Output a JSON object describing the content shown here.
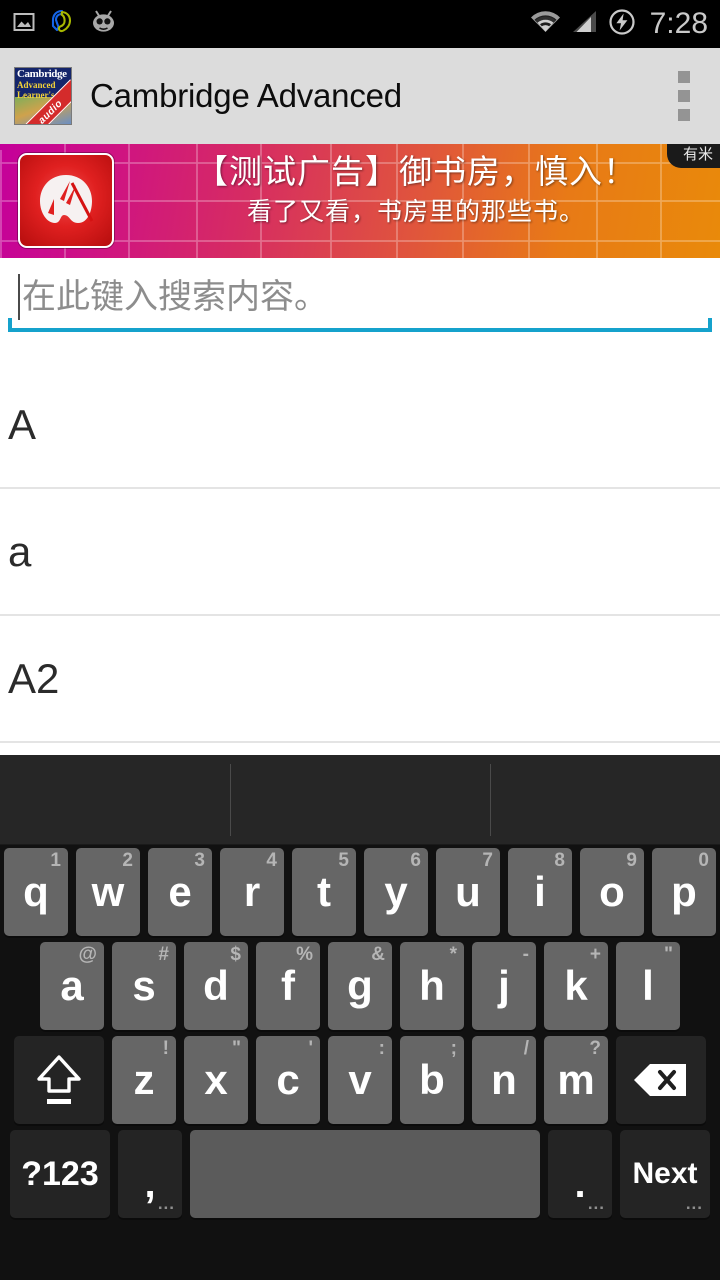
{
  "statusbar": {
    "time": "7:28",
    "left_icons": [
      {
        "name": "screenshot-icon",
        "label": "screenshot"
      },
      {
        "name": "headset-icon",
        "label": "headset"
      },
      {
        "name": "cyanogenmod-icon",
        "label": "cyanogenmod"
      }
    ],
    "right_icons": [
      {
        "name": "wifi-icon",
        "label": "wifi"
      },
      {
        "name": "cellular-signal-icon",
        "label": "signal"
      },
      {
        "name": "battery-charging-icon",
        "label": "charging"
      }
    ]
  },
  "actionbar": {
    "title": "Cambridge Advanced",
    "app_icon": {
      "line1": "Cambridge",
      "line2": "Advanced",
      "line3": "Learner's",
      "ribbon": "audio"
    },
    "overflow_label": "More options"
  },
  "ad": {
    "headline": "【测试广告】御书房，慎入！",
    "subline": "看了又看，书房里的那些书。",
    "tag": "有米",
    "colors": {
      "gradient_start": "#c4009a",
      "gradient_end": "#e98a0a",
      "logo_red": "#e02020"
    }
  },
  "search": {
    "value": "",
    "placeholder": "在此键入搜索内容。",
    "underline_color": "#15a2cc"
  },
  "results": [
    {
      "label": "A"
    },
    {
      "label": "a"
    },
    {
      "label": "A2"
    }
  ],
  "keyboard": {
    "suggestions": [
      "",
      "",
      ""
    ],
    "rows": [
      [
        {
          "key": "q",
          "hint": "1"
        },
        {
          "key": "w",
          "hint": "2"
        },
        {
          "key": "e",
          "hint": "3"
        },
        {
          "key": "r",
          "hint": "4"
        },
        {
          "key": "t",
          "hint": "5"
        },
        {
          "key": "y",
          "hint": "6"
        },
        {
          "key": "u",
          "hint": "7"
        },
        {
          "key": "i",
          "hint": "8"
        },
        {
          "key": "o",
          "hint": "9"
        },
        {
          "key": "p",
          "hint": "0"
        }
      ],
      [
        {
          "key": "a",
          "hint": "@"
        },
        {
          "key": "s",
          "hint": "#"
        },
        {
          "key": "d",
          "hint": "$"
        },
        {
          "key": "f",
          "hint": "%"
        },
        {
          "key": "g",
          "hint": "&"
        },
        {
          "key": "h",
          "hint": "*"
        },
        {
          "key": "j",
          "hint": "-"
        },
        {
          "key": "k",
          "hint": "+"
        },
        {
          "key": "l",
          "hint": "\""
        }
      ],
      [
        {
          "key": "z",
          "hint": "!"
        },
        {
          "key": "x",
          "hint": "\""
        },
        {
          "key": "c",
          "hint": "'"
        },
        {
          "key": "v",
          "hint": ":"
        },
        {
          "key": "b",
          "hint": ";"
        },
        {
          "key": "n",
          "hint": "/"
        },
        {
          "key": "m",
          "hint": "?"
        }
      ]
    ],
    "shift_label": "shift",
    "backspace_label": "delete",
    "symbols_label": "?123",
    "comma_label": ",",
    "comma_dots": "...",
    "space_label": "",
    "period_label": ".",
    "period_dots": "...",
    "enter_label": "Next",
    "enter_dots": "..."
  }
}
